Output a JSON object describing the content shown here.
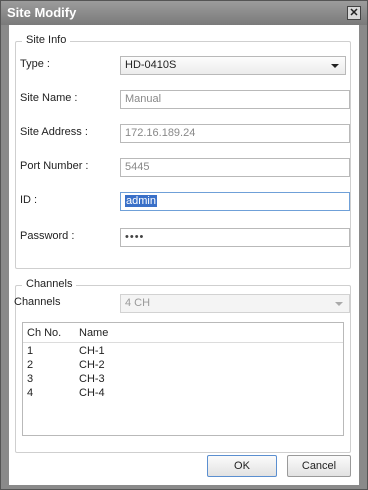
{
  "dialog": {
    "title": "Site Modify"
  },
  "site_info": {
    "group_title": "Site Info",
    "type_label": "Type :",
    "type_value": "HD-0410S",
    "site_name_label": "Site Name :",
    "site_name_value": "Manual",
    "site_address_label": "Site Address :",
    "site_address_value": "172.16.189.24",
    "port_number_label": "Port Number :",
    "port_number_value": "5445",
    "id_label": "ID :",
    "id_value": "admin",
    "password_label": "Password :",
    "password_value": "••••"
  },
  "channels": {
    "group_title": "Channels",
    "channels_label": "Channels",
    "channels_value": "4 CH",
    "list": {
      "col_ch_no": "Ch No.",
      "col_name": "Name",
      "rows": [
        {
          "no": "1",
          "name": "CH-1"
        },
        {
          "no": "2",
          "name": "CH-2"
        },
        {
          "no": "3",
          "name": "CH-3"
        },
        {
          "no": "4",
          "name": "CH-4"
        }
      ]
    }
  },
  "buttons": {
    "ok": "OK",
    "cancel": "Cancel"
  },
  "icons": {
    "close": "close-icon",
    "dropdown": "chevron-down-icon"
  }
}
